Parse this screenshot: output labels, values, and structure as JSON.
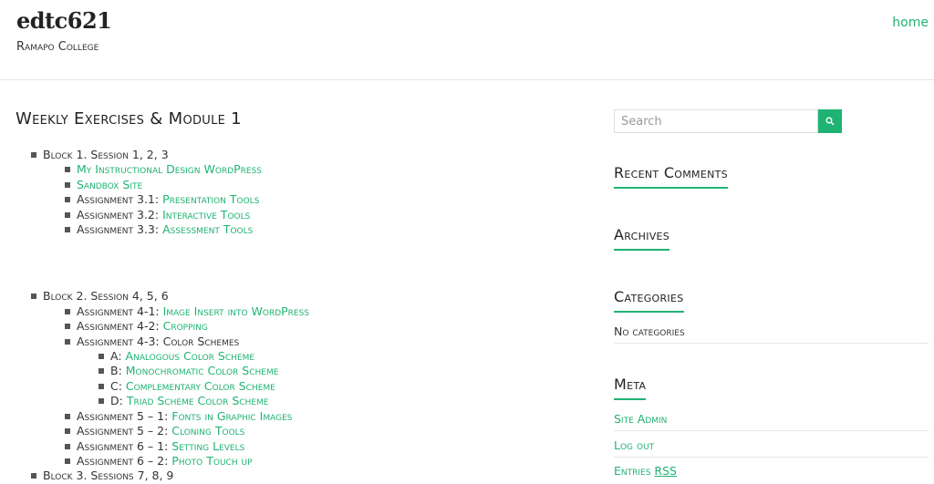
{
  "header": {
    "site_title": "edtc621",
    "site_description": "Ramapo College",
    "nav_home": "home"
  },
  "main": {
    "page_title": "Weekly Exercises & Module 1",
    "block1": {
      "label": "Block 1. Session 1, 2, 3",
      "items": [
        {
          "prefix": "",
          "link": "My Instructional Design WordPress"
        },
        {
          "prefix": "",
          "link": "Sandbox Site"
        },
        {
          "prefix": "Assignment 3.1: ",
          "link": "Presentation Tools"
        },
        {
          "prefix": "Assignment 3.2: ",
          "link": "Interactive Tools"
        },
        {
          "prefix": "Assignment 3.3: ",
          "link": "Assessment Tools"
        }
      ]
    },
    "block2": {
      "label": "Block 2. Session 4, 5, 6",
      "items": [
        {
          "prefix": "Assignment 4-1: ",
          "link": "Image Insert into WordPress"
        },
        {
          "prefix": "Assignment 4-2: ",
          "link": "Cropping"
        },
        {
          "prefix": "Assignment 4-3: Color Schemes",
          "link": ""
        },
        {
          "prefix": "Assignment 5 – 1: ",
          "link": "Fonts in Graphic Images"
        },
        {
          "prefix": "Assignment 5 – 2: ",
          "link": "Cloning Tools"
        },
        {
          "prefix": "Assignment 6 – 1: ",
          "link": "Setting Levels"
        },
        {
          "prefix": "Assignment 6 – 2: ",
          "link": "Photo Touch up"
        }
      ],
      "color_schemes": [
        {
          "prefix": "A: ",
          "link": "Analogous Color Scheme"
        },
        {
          "prefix": "B: ",
          "link": "Monochromatic Color Scheme"
        },
        {
          "prefix": "C: ",
          "link": "Complementary Color Scheme"
        },
        {
          "prefix": "D: ",
          "link": "Triad Scheme Color Scheme"
        }
      ]
    },
    "block3": {
      "label": "Block 3. Sessions 7, 8, 9"
    }
  },
  "sidebar": {
    "search": {
      "placeholder": "Search",
      "value": ""
    },
    "recent_comments_title": "Recent Comments",
    "archives_title": "Archives",
    "categories_title": "Categories",
    "categories_empty": "No categories",
    "meta_title": "Meta",
    "meta_links": [
      "Site Admin",
      "Log out",
      "Entries "
    ],
    "rss_label": "RSS"
  },
  "colors": {
    "accent": "#1fb373",
    "text": "#333333"
  }
}
